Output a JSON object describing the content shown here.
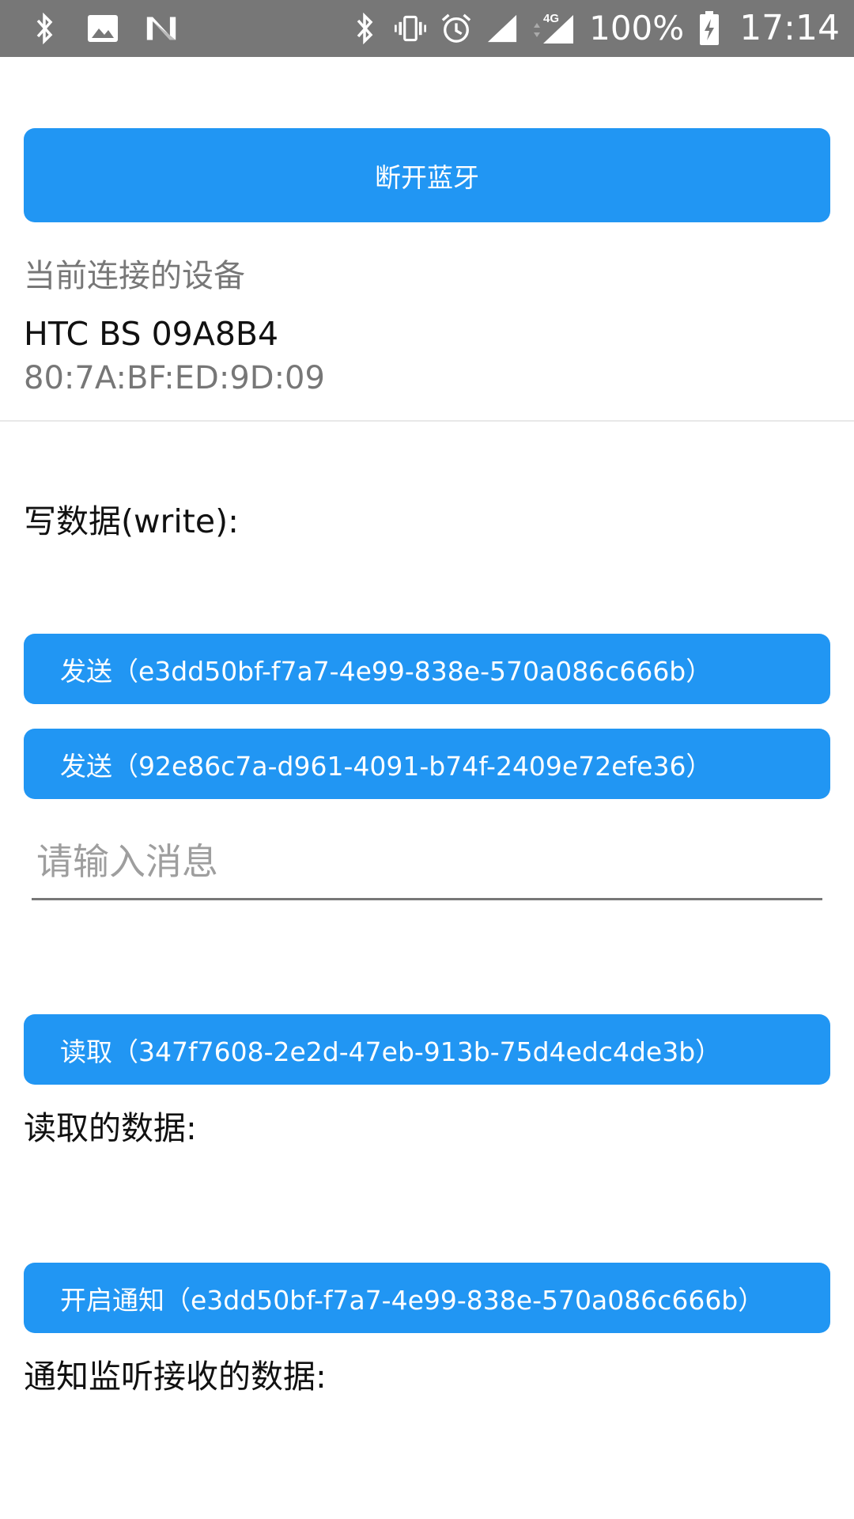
{
  "status_bar": {
    "battery": "100%",
    "time": "17:14",
    "network": "4G",
    "icons": [
      "bluetooth-icon",
      "image-icon",
      "n-icon",
      "bluetooth-icon",
      "vibrate-icon",
      "alarm-icon",
      "signal-icon",
      "signal-4g-icon",
      "battery-charging-icon"
    ]
  },
  "disconnect_button": "断开蓝牙",
  "device": {
    "section_label": "当前连接的设备",
    "name": "HTC BS 09A8B4",
    "mac": "80:7A:BF:ED:9D:09"
  },
  "write": {
    "label": "写数据(write):",
    "send_buttons": [
      "发送（e3dd50bf-f7a7-4e99-838e-570a086c666b）",
      "发送（92e86c7a-d961-4091-b74f-2409e72efe36）"
    ],
    "input_placeholder": "请输入消息",
    "input_value": ""
  },
  "read": {
    "button": "读取（347f7608-2e2d-47eb-913b-75d4edc4de3b）",
    "label": "读取的数据:"
  },
  "notify": {
    "button": "开启通知（e3dd50bf-f7a7-4e99-838e-570a086c666b）",
    "label": "通知监听接收的数据:"
  },
  "colors": {
    "accent": "#2196f3",
    "status_bar": "#777777"
  }
}
